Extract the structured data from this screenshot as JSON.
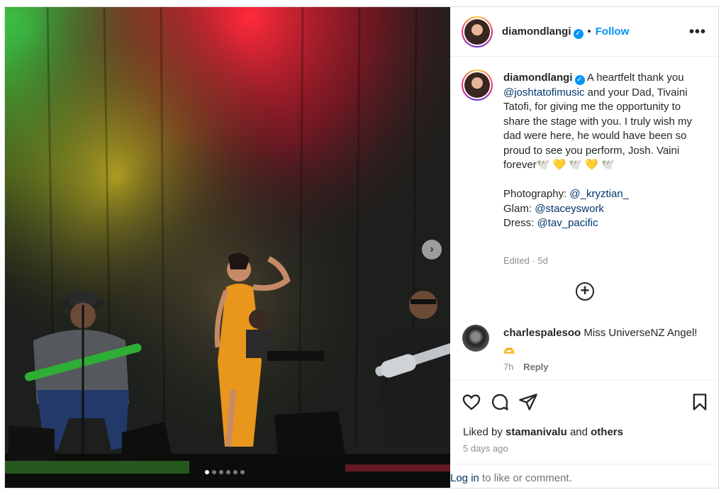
{
  "post": {
    "username": "diamondlangi",
    "verified_icon": "verified-badge-icon",
    "separator": "•",
    "follow_label": "Follow",
    "more_label": "•••",
    "caption": {
      "username": "diamondlangi",
      "line1_pre": "A heartfelt thank you",
      "mention1": "@joshtatofimusic",
      "line2": "and your Dad, Tivaini Tatofi, for giving me the opportunity to share the stage with you. I truly wish my dad were here, he would have been so proud to see you perform, Josh. Vaini forever",
      "emoji_tail": "🕊️ 💛 🕊️ 💛 🕊️",
      "photo_label": "Photography:",
      "photo_mention": "@_kryztian_",
      "glam_label": "Glam:",
      "glam_mention": "@staceyswork",
      "dress_label": "Dress:",
      "dress_mention": "@tav_pacific",
      "edited": "Edited · 5d"
    },
    "add_comment_icon": "plus-circle-icon",
    "comment": {
      "username": "charlespalesoo",
      "text": "Miss UniverseNZ Angel!",
      "emoji": "🫶",
      "time": "7h",
      "reply_label": "Reply"
    },
    "liked_by_prefix": "Liked by",
    "liked_by_user": "stamanivalu",
    "liked_by_and": "and",
    "liked_by_others": "others",
    "time_ago": "5 days ago",
    "login_link": "Log in",
    "login_rest": "to like or comment.",
    "carousel_total": 6,
    "carousel_active": 1,
    "next_label": "›"
  }
}
